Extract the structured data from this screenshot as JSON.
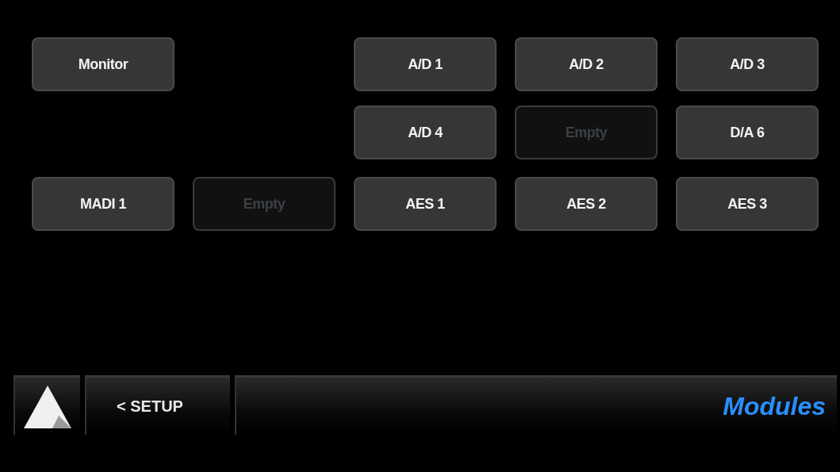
{
  "module_rows": [
    [
      {
        "kind": "module",
        "label": "Monitor"
      },
      {
        "kind": "blank"
      },
      {
        "kind": "module",
        "label": "A/D 1"
      },
      {
        "kind": "module",
        "label": "A/D 2"
      },
      {
        "kind": "module",
        "label": "A/D 3"
      }
    ],
    [
      {
        "kind": "blank"
      },
      {
        "kind": "blank"
      },
      {
        "kind": "module",
        "label": "A/D 4"
      },
      {
        "kind": "empty",
        "label": "Empty"
      },
      {
        "kind": "module",
        "label": "D/A 6"
      }
    ],
    [
      {
        "kind": "module",
        "label": "MADI 1"
      },
      {
        "kind": "empty",
        "label": "Empty"
      },
      {
        "kind": "module",
        "label": "AES 1"
      },
      {
        "kind": "module",
        "label": "AES 2"
      },
      {
        "kind": "module",
        "label": "AES 3"
      }
    ]
  ],
  "bottom_bar": {
    "back_button": "< SETUP",
    "title": "Modules"
  }
}
